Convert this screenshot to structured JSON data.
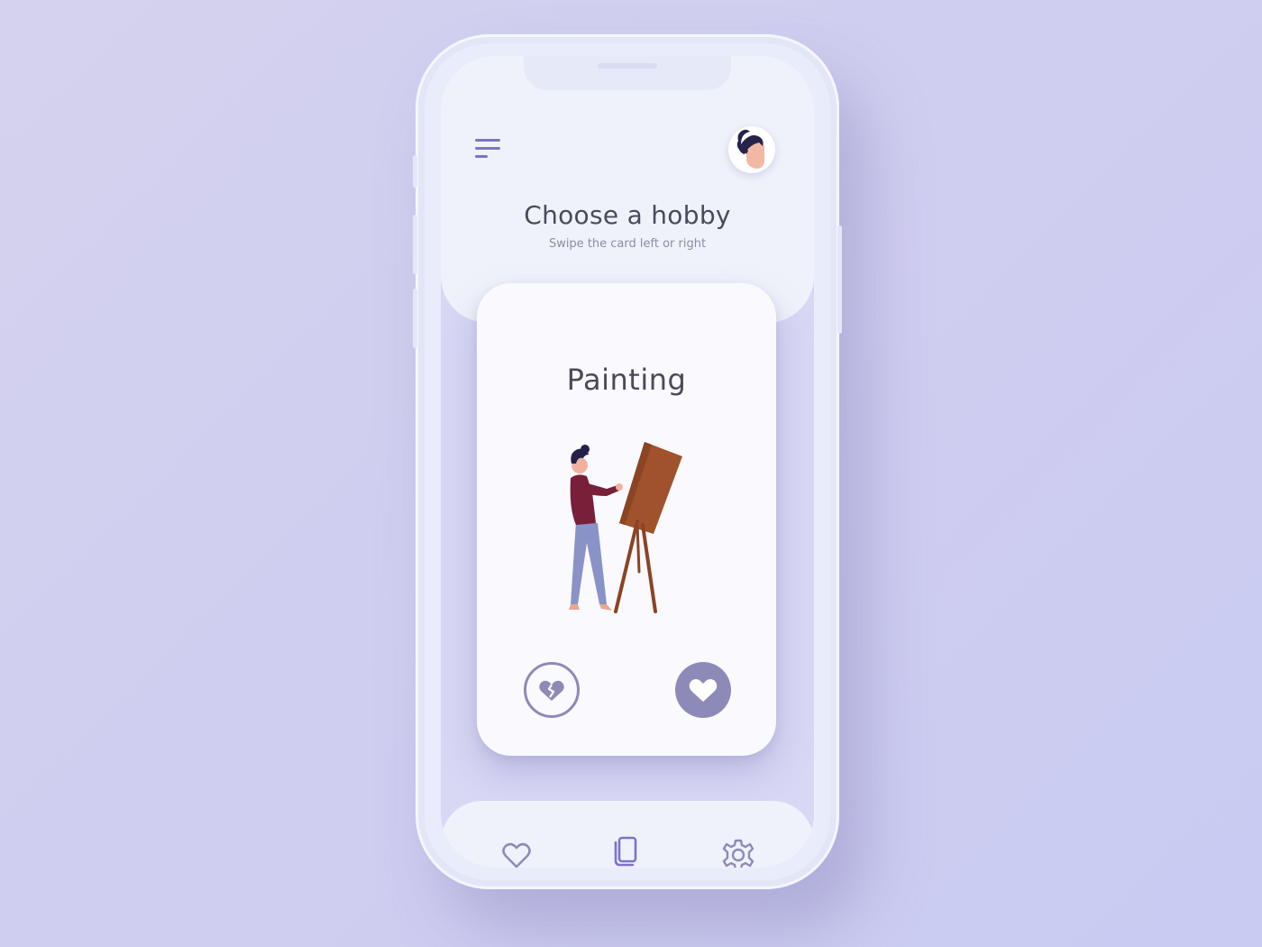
{
  "header": {
    "title": "Choose a hobby",
    "subtitle": "Swipe the card left or right"
  },
  "card": {
    "title": "Painting"
  },
  "icons": {
    "menu": "menu-icon",
    "avatar": "avatar",
    "dislike": "broken-heart-icon",
    "like": "heart-icon",
    "nav_favorites": "heart-outline-icon",
    "nav_cards": "cards-icon",
    "nav_settings": "gear-icon"
  },
  "colors": {
    "background": "#d4d2ee",
    "accent": "#7b74c9",
    "button": "#8e8ab8",
    "card": "#fafafe",
    "panel": "#f0f2fb",
    "text": "#4a4a5e"
  },
  "navigation": {
    "active": "cards"
  }
}
